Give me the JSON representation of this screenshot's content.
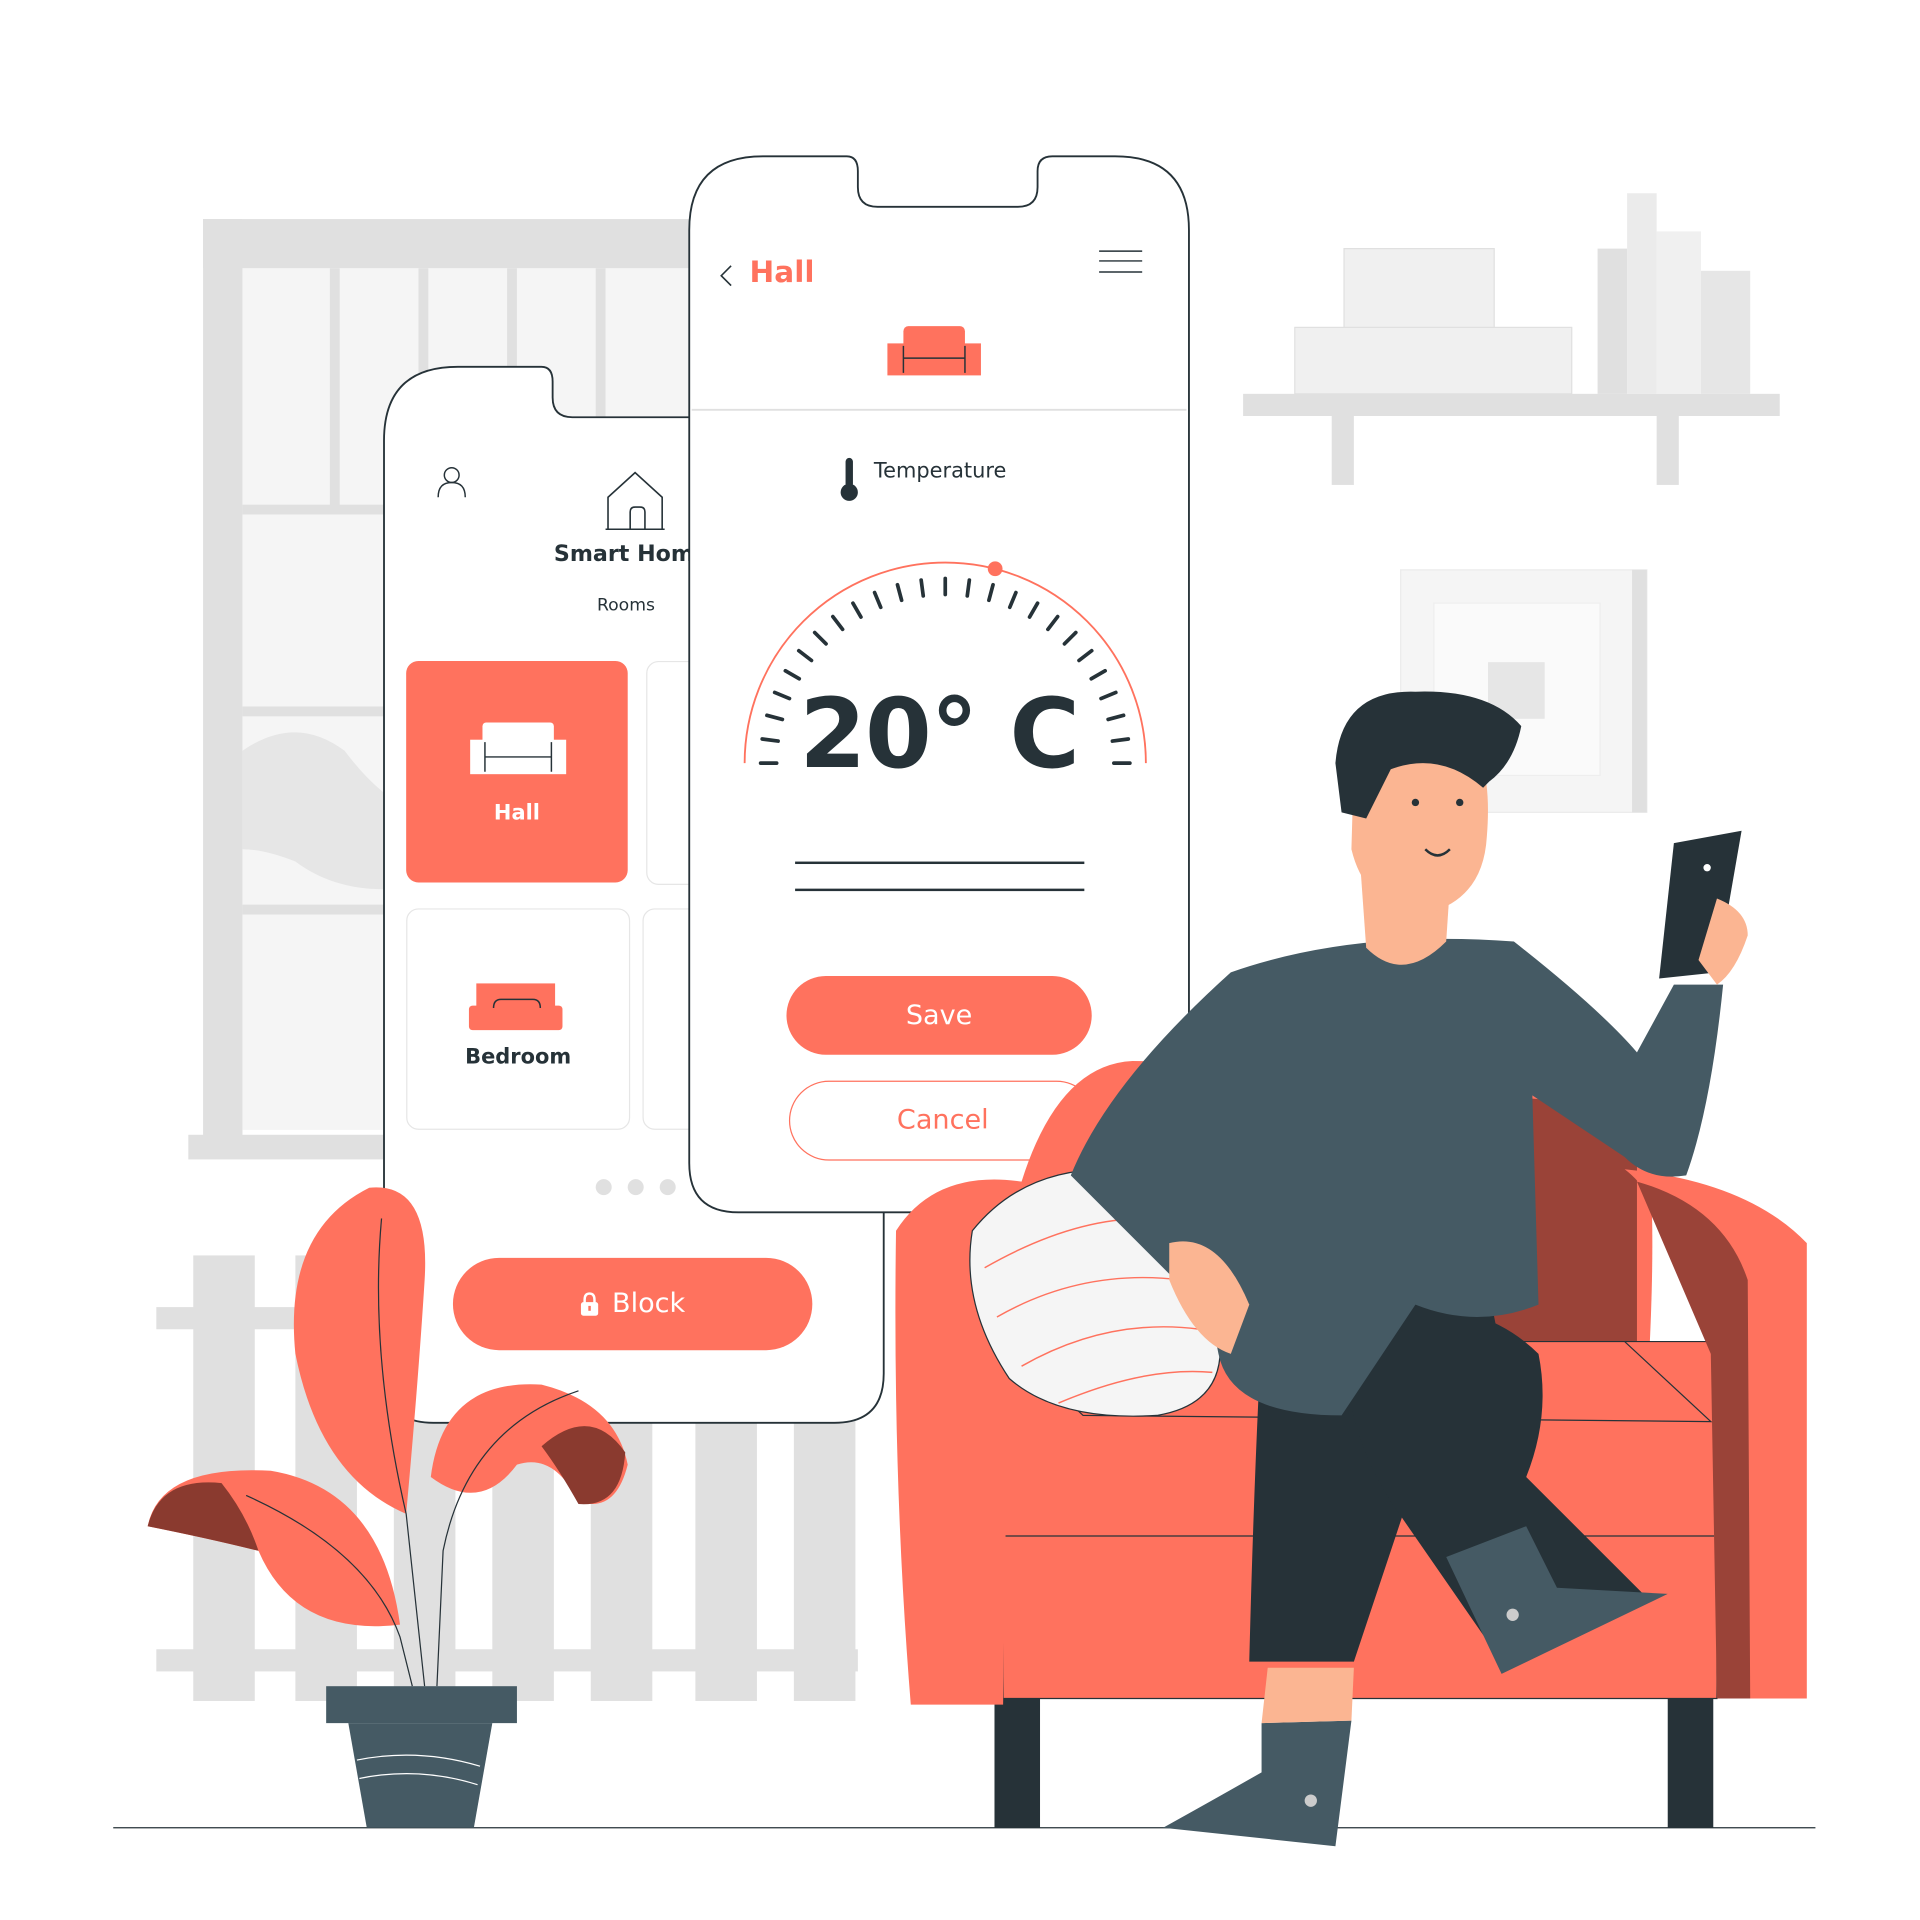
{
  "colors": {
    "accent": "#ff725e",
    "dark": "#263238",
    "slate": "#455a64",
    "maroon": "#9a4338",
    "gray": "#e0e0e0"
  },
  "rooms_screen": {
    "title": "Smart Home",
    "subtitle": "Rooms",
    "icons": {
      "profile": "user-icon",
      "home": "house-icon",
      "lock": "lock-icon"
    },
    "rooms": [
      {
        "label": "Hall",
        "icon": "sofa-icon",
        "selected": true
      },
      {
        "label": "Bedroom",
        "icon": "bed-icon",
        "selected": false
      }
    ],
    "pagination": {
      "pages": 3
    },
    "block_label": "Block"
  },
  "room_screen": {
    "back_icon": "chevron-left-icon",
    "title": "Hall",
    "menu_icon": "hamburger-menu-icon",
    "room_icon": "sofa-icon",
    "temperature_label": "Temperature",
    "temperature_icon": "thermometer-icon",
    "temperature_value": "20° C",
    "dial_position": 0.58,
    "save_label": "Save",
    "cancel_label": "Cancel"
  }
}
